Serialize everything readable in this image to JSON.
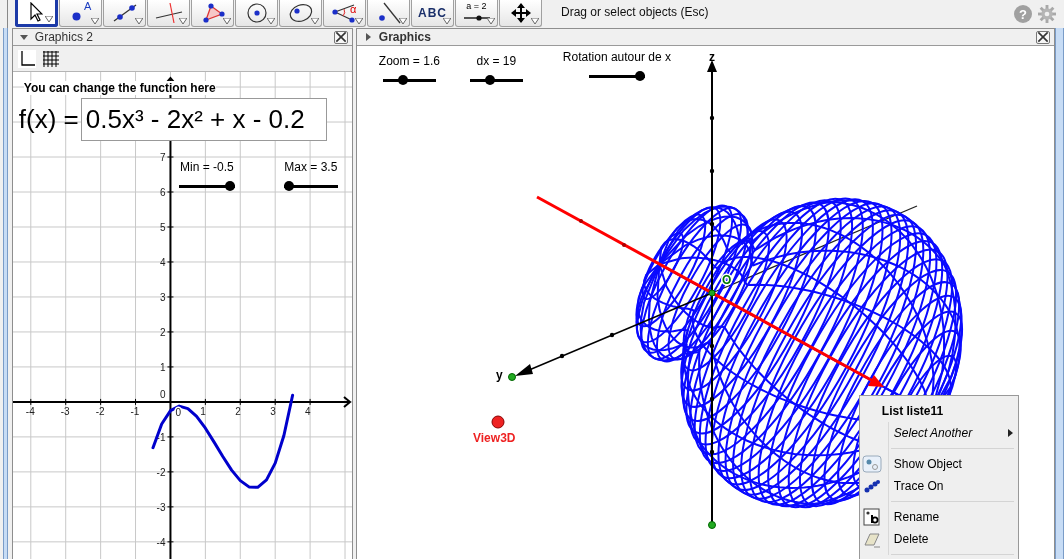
{
  "toolbar": {
    "tools": [
      {
        "kind": "move",
        "selected": true
      },
      {
        "kind": "point",
        "selected": false,
        "label": "A"
      },
      {
        "kind": "line",
        "selected": false
      },
      {
        "kind": "perpendicular",
        "selected": false
      },
      {
        "kind": "polygon",
        "selected": false
      },
      {
        "kind": "circle",
        "selected": false
      },
      {
        "kind": "conic",
        "selected": false
      },
      {
        "kind": "angle",
        "selected": false,
        "label": "α"
      },
      {
        "kind": "reflect",
        "selected": false
      },
      {
        "kind": "text",
        "selected": false,
        "label": "ABC"
      },
      {
        "kind": "slider",
        "selected": false,
        "label": "a = 2"
      },
      {
        "kind": "move_view",
        "selected": false
      }
    ],
    "tool_help": "Drag or select objects (Esc)",
    "help_button": "?"
  },
  "graphics_2": {
    "title": "Graphics 2",
    "expanded": true,
    "caption": "You can change the function here",
    "function_label": "f(x) =",
    "function_value": "0.5x³ - 2x² + x - 0.2",
    "sliders": [
      {
        "label": "Min = -0.5",
        "level": 1
      },
      {
        "label": "Max = 3.5",
        "level": 0
      }
    ],
    "chart_data": {
      "type": "line",
      "x": [
        -0.5,
        -0.25,
        0,
        0.25,
        0.5,
        0.75,
        1,
        1.25,
        1.5,
        1.75,
        2,
        2.25,
        2.5,
        2.75,
        3,
        3.25,
        3.5
      ],
      "series": [
        {
          "color": "#0000cc",
          "values": [
            -1.31,
            -0.63,
            -0.25,
            -0.12,
            -0.19,
            -0.41,
            -0.75,
            -1.15,
            -1.56,
            -1.95,
            -2.25,
            -2.43,
            -2.44,
            -2.23,
            -1.75,
            -0.96,
            0.19
          ]
        }
      ],
      "grid": true,
      "xlim": [
        -4.51,
        5.2
      ],
      "ylim": [
        -4.49,
        9.43
      ],
      "xticks": [
        -4,
        -3,
        -2,
        -1,
        1,
        2,
        3,
        4
      ],
      "yticks": [
        -4,
        -3,
        -2,
        -1,
        1,
        2,
        3,
        4,
        5,
        6,
        7
      ]
    },
    "origin_labels": [
      "0",
      "0"
    ]
  },
  "graphics": {
    "title": "Graphics",
    "expanded": false,
    "sliders": [
      {
        "label": "Zoom = 1.6",
        "level": 0.35
      },
      {
        "label": "dx = 19",
        "level": 0.35
      },
      {
        "label": "Rotation autour de x",
        "level": 1
      }
    ],
    "axis_labels": [
      "z",
      "y"
    ],
    "origin_label": "O",
    "point_label": "View3D",
    "context_menu": {
      "title": "List liste11",
      "items": [
        {
          "kind": "submenu",
          "label": "Select Another"
        },
        {
          "kind": "separator"
        },
        {
          "kind": "show",
          "label": "Show Object"
        },
        {
          "kind": "trace",
          "label": "Trace On"
        },
        {
          "kind": "separator"
        },
        {
          "kind": "rename",
          "label": "Rename"
        },
        {
          "kind": "delete",
          "label": "Delete"
        },
        {
          "kind": "separator"
        }
      ]
    }
  }
}
